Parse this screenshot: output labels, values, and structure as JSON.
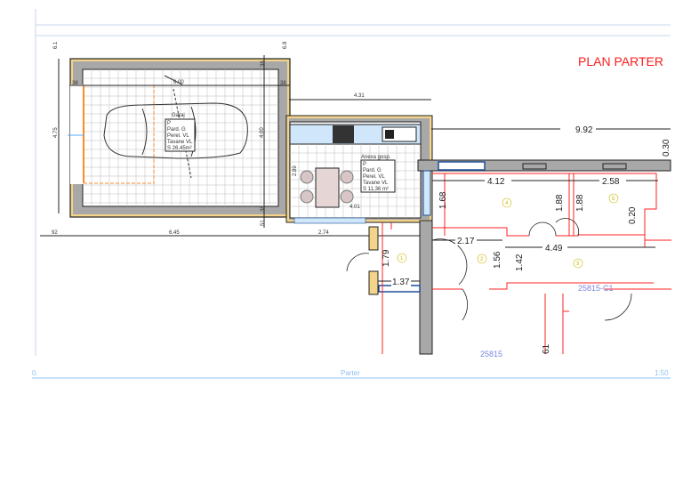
{
  "title": "PLAN PARTER",
  "footer": {
    "left": "0.",
    "center": "Parter",
    "right": "1:50"
  },
  "colors": {
    "title": "#ff1a1a",
    "footer": "#8fc2f0",
    "wall_new": "#ff2020",
    "wall_existing": "#a8a8a8",
    "insulation": "#f3d48a",
    "glazing": "#1d4f9a",
    "counter": "#cfe6fb"
  },
  "garage": {
    "room_name": "Garaj",
    "table_rows": [
      "P",
      "Pard.   G",
      "Perei.  VL",
      "Tavane  VL",
      "S  26,45m²"
    ],
    "dims": {
      "height_outer": "4.75",
      "height_inner": "4.00",
      "width_inner": "6.00",
      "top_offset": "6.1",
      "right_offset": "6.8",
      "wall_left": "38",
      "wall_right": "38",
      "wall_top": "38",
      "wall_bottom": "38",
      "bottom_offset": "51"
    }
  },
  "annex": {
    "room_name": "Anexa gosp.",
    "table_rows": [
      "P",
      "Pard.   G",
      "Perei.  VL",
      "Tavane  VL",
      "S  11,36 m²"
    ],
    "dims": {
      "width": "4.31",
      "height": "2.89",
      "inner": "4.01"
    }
  },
  "bottom_dims": [
    "92",
    "6.45",
    "2.74"
  ],
  "house": {
    "dims": {
      "overall": "9.92",
      "wall": "0.30",
      "room4_width": "4.12",
      "room5_width": "2.58",
      "room4_height": "1.88",
      "room5_height": "1.88",
      "hall_depth": "1.68",
      "room2_width": "2.17",
      "room2_h1": "1.56",
      "room2_h2": "1.42",
      "room3_width": "4.49",
      "gap": "0.20",
      "room1_height": "1.79",
      "room1_width": "1.37",
      "bottom_partial": "61"
    },
    "room_numbers": [
      "1",
      "2",
      "3",
      "4",
      "5"
    ],
    "labels": [
      "25815-C1",
      "25815"
    ]
  }
}
